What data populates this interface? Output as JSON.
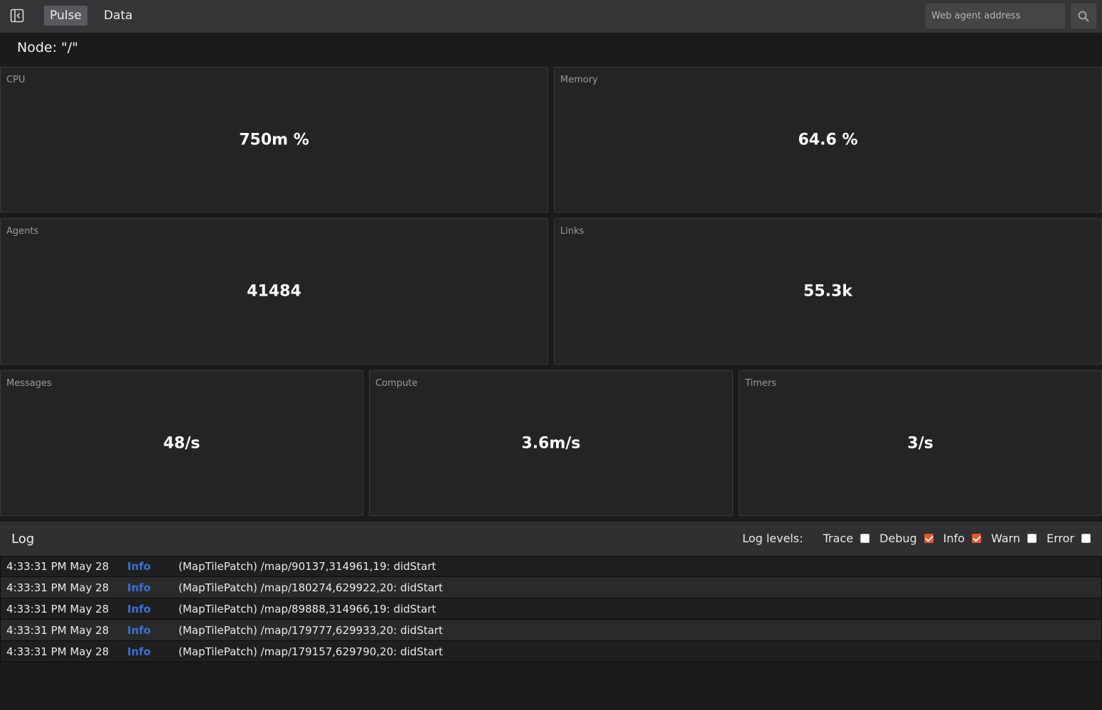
{
  "header": {
    "tabs": [
      {
        "label": "Pulse",
        "active": true
      },
      {
        "label": "Data",
        "active": false
      }
    ],
    "search": {
      "placeholder": "Web agent address",
      "value": ""
    }
  },
  "node": {
    "title": "Node: \"/\""
  },
  "metrics": {
    "cpu": {
      "label": "CPU",
      "value": "750m %"
    },
    "memory": {
      "label": "Memory",
      "value": "64.6 %"
    },
    "agents": {
      "label": "Agents",
      "value": "41484"
    },
    "links": {
      "label": "Links",
      "value": "55.3k"
    },
    "messages": {
      "label": "Messages",
      "value": "48/s"
    },
    "compute": {
      "label": "Compute",
      "value": "3.6m/s"
    },
    "timers": {
      "label": "Timers",
      "value": "3/s"
    }
  },
  "log": {
    "title": "Log",
    "levels_label": "Log levels:",
    "levels": [
      {
        "name": "Trace",
        "checked": false
      },
      {
        "name": "Debug",
        "checked": true
      },
      {
        "name": "Info",
        "checked": true
      },
      {
        "name": "Warn",
        "checked": false
      },
      {
        "name": "Error",
        "checked": false
      }
    ],
    "entries": [
      {
        "time": "4:33:31 PM May 28",
        "level": "Info",
        "message": "(MapTilePatch) /map/90137,314961,19: didStart"
      },
      {
        "time": "4:33:31 PM May 28",
        "level": "Info",
        "message": "(MapTilePatch) /map/180274,629922,20: didStart"
      },
      {
        "time": "4:33:31 PM May 28",
        "level": "Info",
        "message": "(MapTilePatch) /map/89888,314966,19: didStart"
      },
      {
        "time": "4:33:31 PM May 28",
        "level": "Info",
        "message": "(MapTilePatch) /map/179777,629933,20: didStart"
      },
      {
        "time": "4:33:31 PM May 28",
        "level": "Info",
        "message": "(MapTilePatch) /map/179157,629790,20: didStart"
      }
    ]
  },
  "colors": {
    "accent_checkbox": "#e8572a",
    "info_level": "#3a6fd8",
    "topbar": "#353538",
    "background": "#1b1b1c"
  },
  "icons": {
    "sidebar_toggle": "sidebar-toggle-icon",
    "search": "search-icon"
  }
}
